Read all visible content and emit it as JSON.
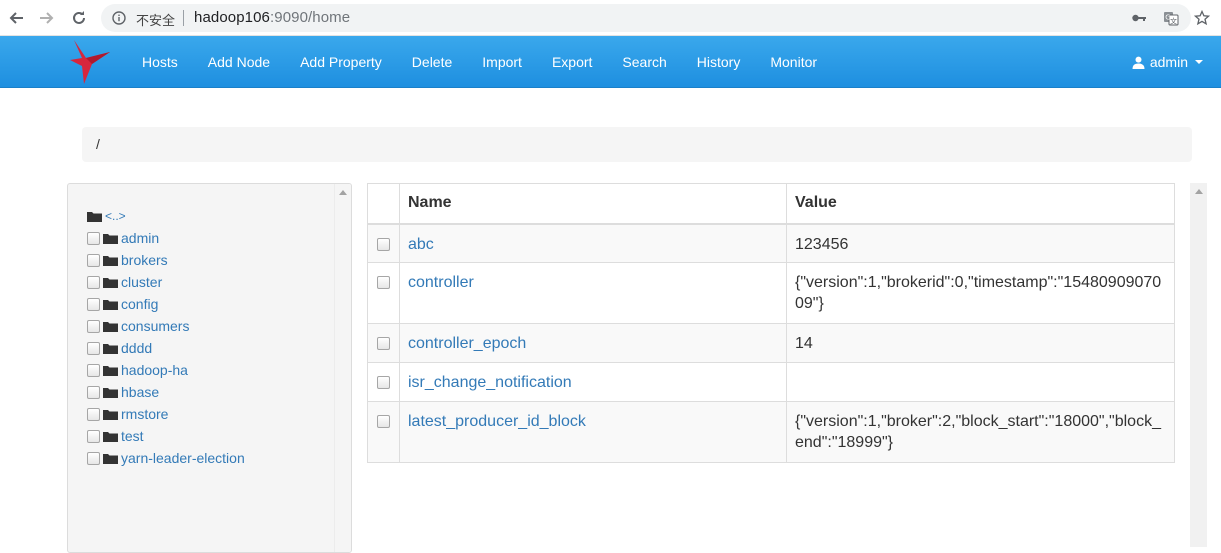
{
  "browser": {
    "insecure_label": "不安全",
    "url_host": "hadoop106",
    "url_rest": ":9090/home"
  },
  "navbar": {
    "links": [
      "Hosts",
      "Add Node",
      "Add Property",
      "Delete",
      "Import",
      "Export",
      "Search",
      "History",
      "Monitor"
    ],
    "user": "admin"
  },
  "breadcrumb": "/",
  "tree": {
    "up_label": "<..>",
    "items": [
      "admin",
      "brokers",
      "cluster",
      "config",
      "consumers",
      "dddd",
      "hadoop-ha",
      "hbase",
      "rmstore",
      "test",
      "yarn-leader-election"
    ]
  },
  "table": {
    "headers": {
      "name": "Name",
      "value": "Value"
    },
    "rows": [
      {
        "name": "abc",
        "value": "123456"
      },
      {
        "name": "controller",
        "value": "{\"version\":1,\"brokerid\":0,\"timestamp\":\"1548090907009\"}"
      },
      {
        "name": "controller_epoch",
        "value": "14"
      },
      {
        "name": "isr_change_notification",
        "value": ""
      },
      {
        "name": "latest_producer_id_block",
        "value": "{\"version\":1,\"broker\":2,\"block_start\":\"18000\",\"block_end\":\"18999\"}"
      }
    ]
  },
  "colors": {
    "navbar": "#2b9be6",
    "link": "#337ab7"
  }
}
